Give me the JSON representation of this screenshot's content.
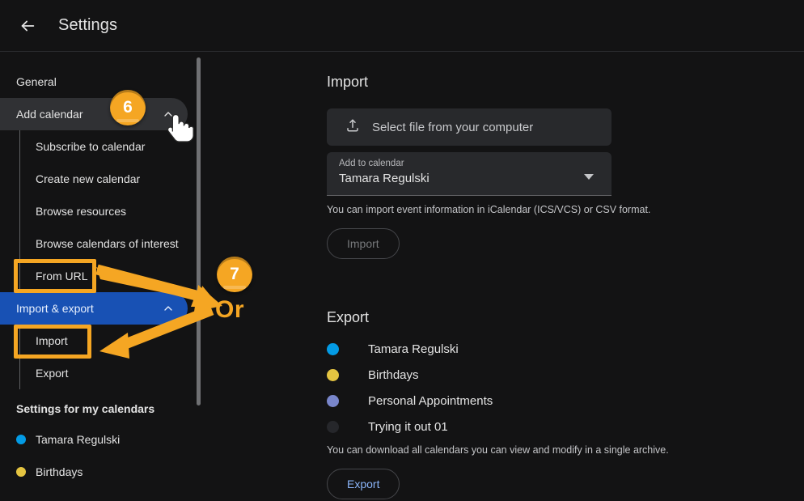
{
  "header": {
    "title": "Settings",
    "back_icon": "arrow-left-icon"
  },
  "sidebar": {
    "items": [
      {
        "label": "General",
        "state": "normal"
      },
      {
        "label": "Add calendar",
        "state": "hovered",
        "chevron": "chevron-up-icon"
      }
    ],
    "add_calendar_children": [
      {
        "label": "Subscribe to calendar"
      },
      {
        "label": "Create new calendar"
      },
      {
        "label": "Browse resources"
      },
      {
        "label": "Browse calendars of interest"
      },
      {
        "label": "From URL"
      }
    ],
    "import_export": {
      "label": "Import & export",
      "state": "selected",
      "chevron": "chevron-up-icon"
    },
    "import_export_children": [
      {
        "label": "Import"
      },
      {
        "label": "Export"
      }
    ],
    "my_calendars_heading": "Settings for my calendars",
    "my_calendars": [
      {
        "label": "Tamara Regulski",
        "color": "#039be5"
      },
      {
        "label": "Birthdays",
        "color": "#e4c441"
      }
    ]
  },
  "main": {
    "import": {
      "title": "Import",
      "file_button_label": "Select file from your computer",
      "file_button_icon": "upload-icon",
      "select_label": "Add to calendar",
      "select_value": "Tamara Regulski",
      "select_icon": "chevron-down-icon",
      "helper_text": "You can import event information in iCalendar (ICS/VCS) or CSV format.",
      "action_label": "Import"
    },
    "export": {
      "title": "Export",
      "calendars": [
        {
          "label": "Tamara Regulski",
          "color": "#039be5"
        },
        {
          "label": "Birthdays",
          "color": "#e4c441"
        },
        {
          "label": "Personal Appointments",
          "color": "#7986cb"
        },
        {
          "label": "Trying it out 01",
          "color": "#26272b"
        }
      ],
      "helper_text": "You can download all calendars you can view and modify in a single archive.",
      "action_label": "Export"
    }
  },
  "annotations": {
    "accent_color": "#f5a623",
    "badge_6": "6",
    "badge_7": "7",
    "or_label": "Or",
    "cursor_icon": "pointer-hand-icon",
    "highlight_from_url": "From URL",
    "highlight_import": "Import"
  }
}
